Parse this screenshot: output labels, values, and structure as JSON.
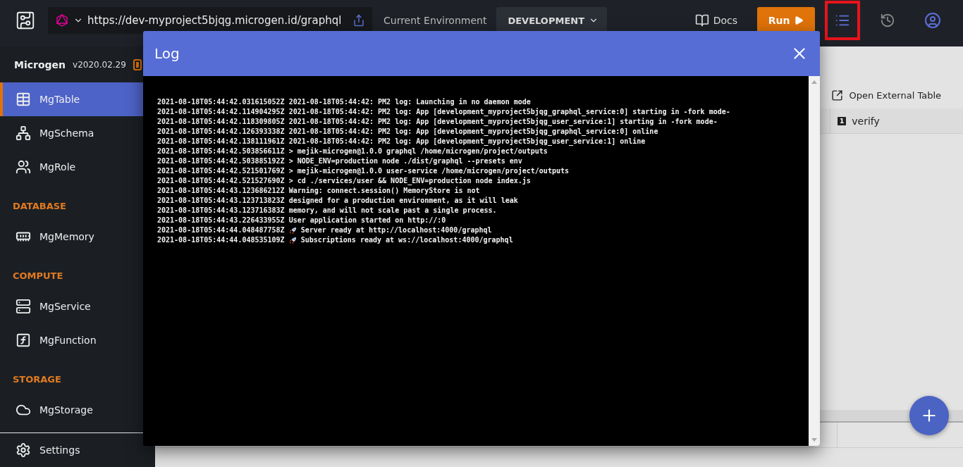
{
  "topbar": {
    "url": "https://dev-myproject5bjqg.microgen.id/graphql",
    "environment_label": "Current Environment",
    "environment": "DEVELOPMENT",
    "docs": "Docs",
    "run": "Run",
    "log_button_highlighted": true
  },
  "sidebar": {
    "brand": "Microgen",
    "version": "v2020.02.29",
    "sections": [
      {
        "items": [
          {
            "label": "MgTable",
            "selected": true
          },
          {
            "label": "MgSchema",
            "selected": false
          },
          {
            "label": "MgRole",
            "selected": false
          }
        ]
      },
      {
        "heading": "DATABASE",
        "items": [
          {
            "label": "MgMemory",
            "selected": false
          }
        ]
      },
      {
        "heading": "COMPUTE",
        "items": [
          {
            "label": "MgService",
            "selected": false
          },
          {
            "label": "MgFunction",
            "selected": false
          }
        ]
      },
      {
        "heading": "STORAGE",
        "items": [
          {
            "label": "MgStorage",
            "selected": false
          }
        ]
      }
    ],
    "settings": "Settings"
  },
  "table": {
    "open_external": "Open External Table",
    "columns": [
      {
        "badge": "1",
        "label": "verify"
      }
    ]
  },
  "log": {
    "title": "Log",
    "lines": [
      {
        "kind": "plain",
        "time": "2021-08-18T05:44:42.031615052Z",
        "text": "2021-08-18T05:44:42: PM2 log: Launching in no daemon mode"
      },
      {
        "kind": "plain",
        "time": "2021-08-18T05:44:42.114904295Z",
        "text": "2021-08-18T05:44:42: PM2 log: App [development_myproject5bjqg_graphql_service:0] starting in -fork mode-"
      },
      {
        "kind": "plain",
        "time": "2021-08-18T05:44:42.118309805Z",
        "text": "2021-08-18T05:44:42: PM2 log: App [development_myproject5bjqg_user_service:1] starting in -fork mode-"
      },
      {
        "kind": "plain",
        "time": "2021-08-18T05:44:42.126393338Z",
        "text": "2021-08-18T05:44:42: PM2 log: App [development_myproject5bjqg_graphql_service:0] online"
      },
      {
        "kind": "plain",
        "time": "2021-08-18T05:44:42.138111961Z",
        "text": "2021-08-18T05:44:42: PM2 log: App [development_myproject5bjqg_user_service:1] online"
      },
      {
        "kind": "plain",
        "time": "2021-08-18T05:44:42.503856611Z",
        "text": "> mejik-microgen@1.0.0 graphql /home/microgen/project/outputs"
      },
      {
        "kind": "plain",
        "time": "2021-08-18T05:44:42.503885192Z",
        "text": "> NODE_ENV=production node ./dist/graphql --presets env"
      },
      {
        "kind": "plain",
        "time": "2021-08-18T05:44:42.521501769Z",
        "text": "> mejik-microgen@1.0.0 user-service /home/microgen/project/outputs"
      },
      {
        "kind": "plain",
        "time": "2021-08-18T05:44:42.521527690Z",
        "text": "> cd ./services/user && NODE_ENV=production node index.js"
      },
      {
        "kind": "plain",
        "time": "2021-08-18T05:44:43.123686212Z",
        "text": "Warning: connect.session() MemoryStore is not"
      },
      {
        "kind": "plain",
        "time": "2021-08-18T05:44:43.123713823Z",
        "text": "designed for a production environment, as it will leak"
      },
      {
        "kind": "plain",
        "time": "2021-08-18T05:44:43.123716383Z",
        "text": "memory, and will not scale past a single process."
      },
      {
        "kind": "plain",
        "time": "2021-08-18T05:44:43.226433955Z",
        "text": "User application started on http://:0"
      },
      {
        "kind": "rocket",
        "time": "2021-08-18T05:44:44.048487758Z",
        "text": "Server ready at http://localhost:4000/graphql"
      },
      {
        "kind": "rocket",
        "time": "2021-08-18T05:44:44.048535109Z",
        "text": "Subscriptions ready at ws://localhost:4000/graphql"
      }
    ]
  }
}
